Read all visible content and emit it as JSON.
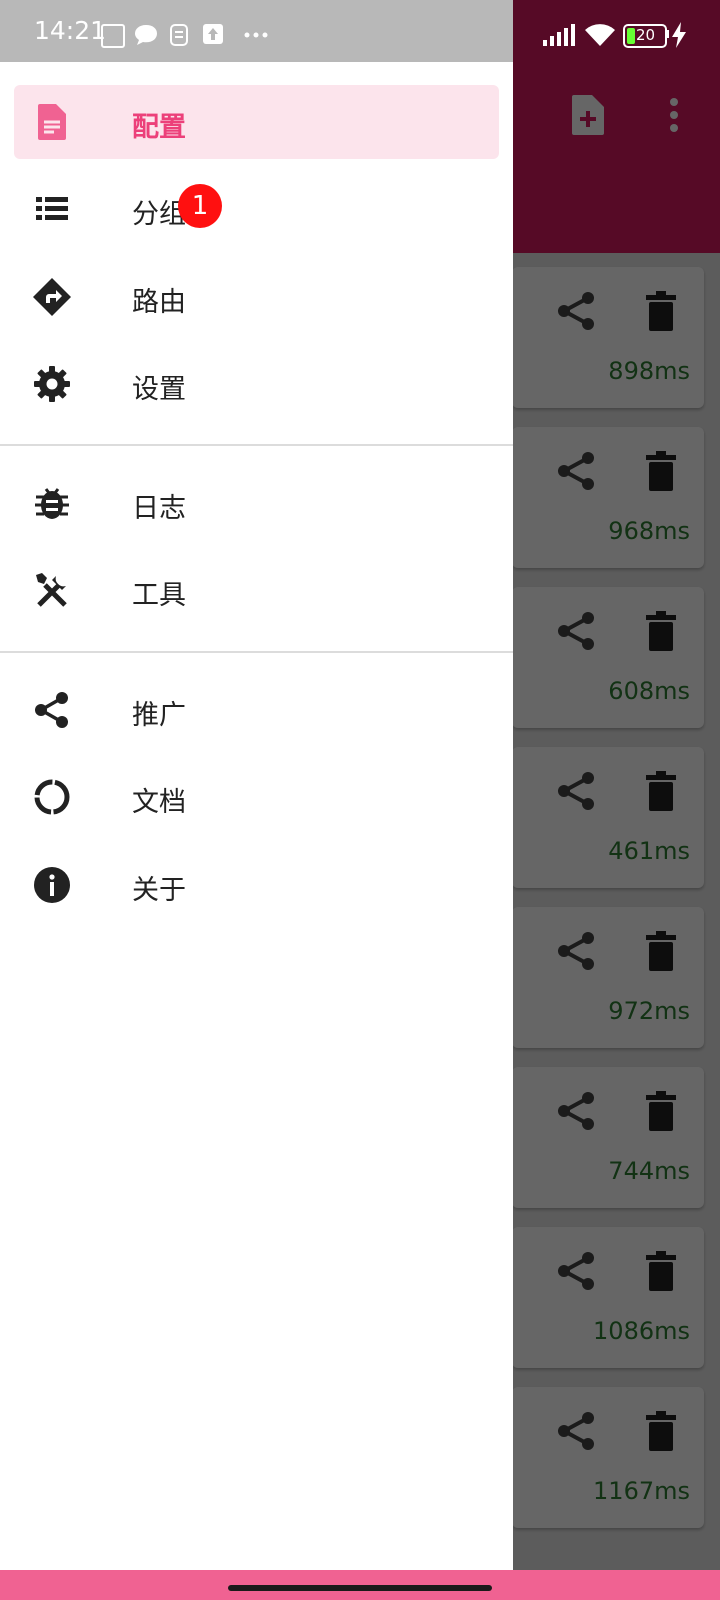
{
  "status_bar": {
    "time": "14:21",
    "battery": "20",
    "icons": [
      "nfc-icon",
      "chat-icon",
      "sim-icon",
      "upload-icon",
      "more-dots-icon",
      "signal-icon",
      "wifi-icon",
      "battery-icon",
      "charging-icon"
    ]
  },
  "drawer": {
    "items": [
      {
        "label": "配置",
        "icon": "profile-doc-icon",
        "active": true
      },
      {
        "label": "分组",
        "icon": "list-icon",
        "badge": "1"
      },
      {
        "label": "路由",
        "icon": "route-icon"
      },
      {
        "label": "设置",
        "icon": "gear-icon"
      },
      {
        "label": "日志",
        "icon": "bug-icon"
      },
      {
        "label": "工具",
        "icon": "tools-icon"
      },
      {
        "label": "推广",
        "icon": "share-icon"
      },
      {
        "label": "文档",
        "icon": "docs-ring-icon"
      },
      {
        "label": "关于",
        "icon": "info-icon"
      }
    ]
  },
  "background": {
    "toolbar_icons": [
      "add-file-icon",
      "overflow-menu-icon"
    ],
    "latencies": [
      "898ms",
      "968ms",
      "608ms",
      "461ms",
      "972ms",
      "744ms",
      "1086ms",
      "1167ms"
    ]
  },
  "colors": {
    "accent": "#ec407a",
    "active_bg": "#fce4ec",
    "toolbar": "#d81b60",
    "latency_text": "#2e7d32",
    "badge": "#ff1010",
    "nav_bar": "#f06292"
  }
}
